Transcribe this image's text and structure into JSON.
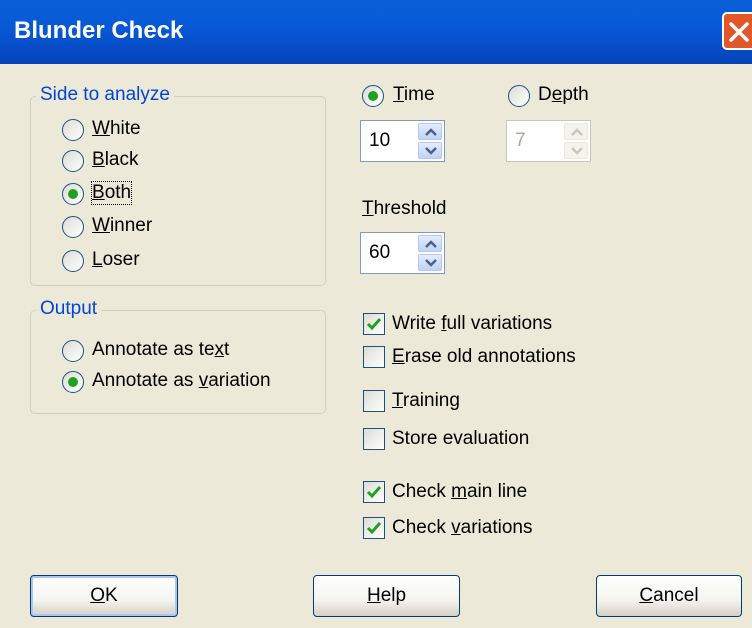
{
  "window": {
    "title": "Blunder Check",
    "close_icon": "close-icon"
  },
  "side_group": {
    "legend": "Side to analyze",
    "options": [
      {
        "label": "White",
        "accel": "W",
        "rest": "hite",
        "selected": false
      },
      {
        "label": "Black",
        "accel": "B",
        "rest": "lack",
        "selected": false
      },
      {
        "label": "Both",
        "accel": "B",
        "rest": "oth",
        "selected": true
      },
      {
        "label": "Winner",
        "accel": "W",
        "rest": "inner",
        "selected": false
      },
      {
        "label": "Loser",
        "accel": "L",
        "rest": "oser",
        "selected": false
      }
    ]
  },
  "output_group": {
    "legend": "Output",
    "options": [
      {
        "label": "Annotate as text",
        "pre": "Annotate as te",
        "accel": "x",
        "rest": "t",
        "selected": false
      },
      {
        "label": "Annotate as variation",
        "pre": "Annotate as ",
        "accel": "v",
        "rest": "ariation",
        "selected": true
      }
    ]
  },
  "mode": {
    "time": {
      "accel": "T",
      "rest": "ime",
      "selected": true,
      "value": "10"
    },
    "depth": {
      "pre": "D",
      "accel": "e",
      "rest": "pth",
      "selected": false,
      "value": "7",
      "disabled": true
    }
  },
  "threshold": {
    "accel": "T",
    "rest": "hreshold",
    "value": "60"
  },
  "options": [
    {
      "pre": "Write ",
      "accel": "f",
      "rest": "ull variations",
      "checked": true
    },
    {
      "pre": "",
      "accel": "E",
      "rest": "rase old annotations",
      "checked": false
    },
    {
      "pre": "",
      "accel": "T",
      "rest": "raining",
      "checked": false
    },
    {
      "pre": "Store evaluation",
      "accel": "",
      "rest": "",
      "checked": false
    },
    {
      "pre": "Check ",
      "accel": "m",
      "rest": "ain line",
      "checked": true
    },
    {
      "pre": "Check ",
      "accel": "v",
      "rest": "ariations",
      "checked": true
    }
  ],
  "buttons": {
    "ok": {
      "accel": "O",
      "rest": "K"
    },
    "help": {
      "accel": "H",
      "rest": "elp"
    },
    "cancel": {
      "accel": "C",
      "rest": "ancel"
    }
  },
  "colors": {
    "accent": "#0046d5",
    "radio_dot": "#21a121",
    "check_mark": "#21a121",
    "titlebar": "#0858d6"
  }
}
